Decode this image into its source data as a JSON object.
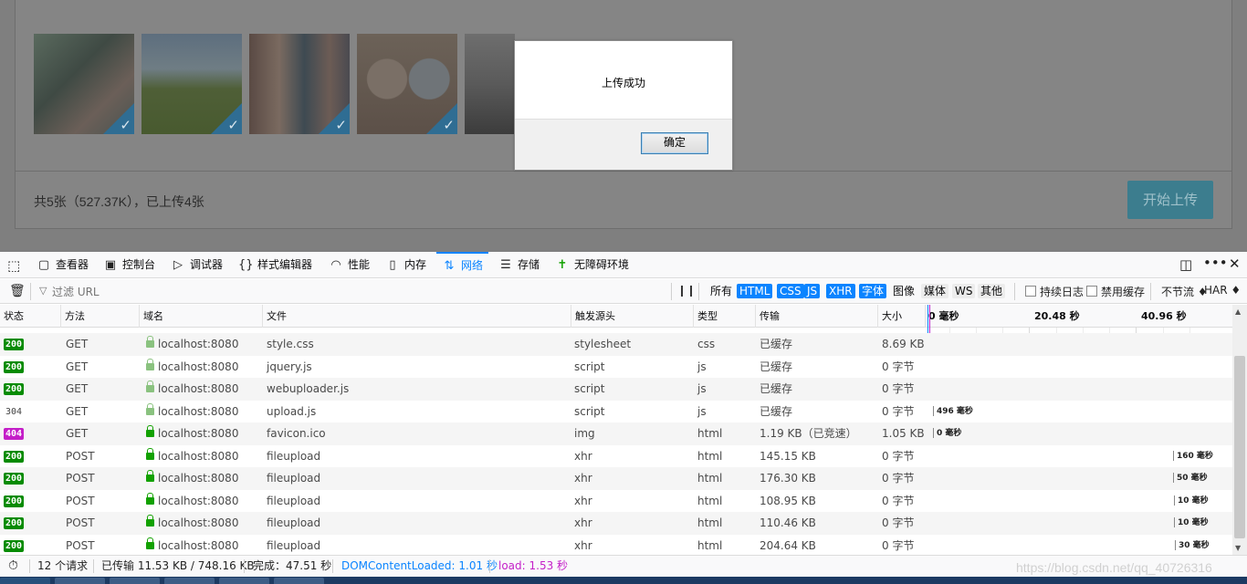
{
  "page": {
    "summary": "共5张（527.37K），已上传4张",
    "start_button": "开始上传"
  },
  "dialog": {
    "message": "上传成功",
    "ok_label": "确定"
  },
  "devtools": {
    "tabs": [
      {
        "label": "查看器",
        "icon": "inspector-icon"
      },
      {
        "label": "控制台",
        "icon": "console-icon"
      },
      {
        "label": "调试器",
        "icon": "debugger-icon"
      },
      {
        "label": "样式编辑器",
        "icon": "style-editor-icon"
      },
      {
        "label": "性能",
        "icon": "performance-icon"
      },
      {
        "label": "内存",
        "icon": "memory-icon"
      },
      {
        "label": "网络",
        "icon": "network-icon"
      },
      {
        "label": "存储",
        "icon": "storage-icon"
      },
      {
        "label": "无障碍环境",
        "icon": "accessibility-icon"
      }
    ],
    "selected_tab": "网络",
    "filter_placeholder": "过滤 URL",
    "type_filters": [
      "所有",
      "HTML",
      "CSS",
      "JS",
      "XHR",
      "字体",
      "图像",
      "媒体",
      "WS",
      "其他"
    ],
    "active_type_filters": [
      "HTML",
      "CSS",
      "JS",
      "XHR",
      "字体"
    ],
    "persist_logs_label": "持续日志",
    "disable_cache_label": "禁用缓存",
    "throttle_label": "不节流 ♦",
    "har_label": "HAR ♦",
    "columns": [
      "状态",
      "方法",
      "域名",
      "文件",
      "触发源头",
      "类型",
      "传输",
      "大小"
    ],
    "timeline_ticks": [
      "0 毫秒",
      "20.48 秒",
      "40.96 秒"
    ],
    "requests": [
      {
        "status": "200",
        "method": "GET",
        "domain": "localhost:8080",
        "file": "style.css",
        "cause": "stylesheet",
        "type": "css",
        "transferred": "已缓存",
        "size": "8.69 KB",
        "timing": ""
      },
      {
        "status": "200",
        "method": "GET",
        "domain": "localhost:8080",
        "file": "jquery.js",
        "cause": "script",
        "type": "js",
        "transferred": "已缓存",
        "size": "0 字节",
        "timing": ""
      },
      {
        "status": "200",
        "method": "GET",
        "domain": "localhost:8080",
        "file": "webuploader.js",
        "cause": "script",
        "type": "js",
        "transferred": "已缓存",
        "size": "0 字节",
        "timing": ""
      },
      {
        "status": "304",
        "method": "GET",
        "domain": "localhost:8080",
        "file": "upload.js",
        "cause": "script",
        "type": "js",
        "transferred": "已缓存",
        "size": "0 字节",
        "timing": "496 毫秒"
      },
      {
        "status": "404",
        "method": "GET",
        "domain": "localhost:8080",
        "file": "favicon.ico",
        "cause": "img",
        "type": "html",
        "transferred": "1.19 KB（已竞速）",
        "size": "1.05 KB",
        "timing": "0 毫秒"
      },
      {
        "status": "200",
        "method": "POST",
        "domain": "localhost:8080",
        "file": "fileupload",
        "cause": "xhr",
        "type": "html",
        "transferred": "145.15 KB",
        "size": "0 字节",
        "timing": "160 毫秒"
      },
      {
        "status": "200",
        "method": "POST",
        "domain": "localhost:8080",
        "file": "fileupload",
        "cause": "xhr",
        "type": "html",
        "transferred": "176.30 KB",
        "size": "0 字节",
        "timing": "50 毫秒"
      },
      {
        "status": "200",
        "method": "POST",
        "domain": "localhost:8080",
        "file": "fileupload",
        "cause": "xhr",
        "type": "html",
        "transferred": "108.95 KB",
        "size": "0 字节",
        "timing": "10 毫秒"
      },
      {
        "status": "200",
        "method": "POST",
        "domain": "localhost:8080",
        "file": "fileupload",
        "cause": "xhr",
        "type": "html",
        "transferred": "110.46 KB",
        "size": "0 字节",
        "timing": "10 毫秒"
      },
      {
        "status": "200",
        "method": "POST",
        "domain": "localhost:8080",
        "file": "fileupload",
        "cause": "xhr",
        "type": "html",
        "transferred": "204.64 KB",
        "size": "0 字节",
        "timing": "30 毫秒"
      }
    ],
    "status_bar": {
      "requests": "12 个请求",
      "transferred": "已传输 11.53 KB / 748.16 KB",
      "finish": "完成：47.51 秒",
      "dom_content_loaded": "DOMContentLoaded: 1.01 秒",
      "load": "load: 1.53 秒"
    }
  },
  "watermark": "https://blog.csdn.net/qq_40726316",
  "colors": {
    "accent": "#0a84ff",
    "status_ok": "#058b00",
    "status_not_found": "#c41fc8",
    "dom_content_loaded": "#0a84ff",
    "load": "#c41fc8"
  }
}
